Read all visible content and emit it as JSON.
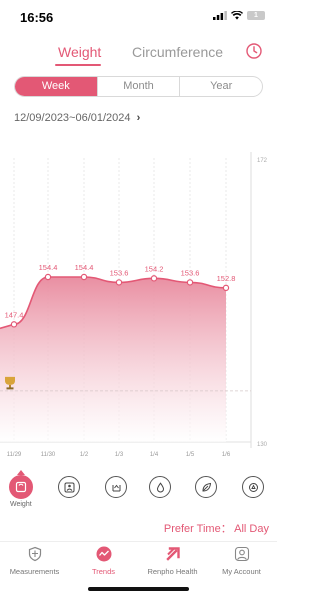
{
  "status": {
    "time": "16:56",
    "battery": "1"
  },
  "tabs": [
    {
      "label": "Weight",
      "active": true
    },
    {
      "label": "Circumference",
      "active": false
    }
  ],
  "period": {
    "options": [
      "Week",
      "Month",
      "Year"
    ],
    "selected": "Week"
  },
  "date_range": "12/09/2023~06/01/2024",
  "date_range_arrow": "›",
  "chart_data": {
    "type": "area",
    "x": [
      "11/29",
      "11/30",
      "1/2",
      "1/3",
      "1/4",
      "1/5",
      "1/6"
    ],
    "values": [
      147.4,
      154.4,
      154.4,
      153.6,
      154.2,
      153.6,
      152.8
    ],
    "value_labels": [
      "147.4",
      "154.4",
      "154.4",
      "153.6",
      "154.2",
      "153.6",
      "152.8"
    ],
    "y_axis_labels": [
      "172",
      "130"
    ],
    "ylim": [
      130,
      172
    ],
    "goal_marker": "trophy-icon",
    "grid": true,
    "colors": {
      "line": "#e35875",
      "fill_top": "#e8899d",
      "fill_bottom": "#ffffff"
    }
  },
  "metrics": [
    {
      "icon": "scale-icon",
      "label": "Weight",
      "active": true
    },
    {
      "icon": "body-fat-icon",
      "label": "",
      "active": false
    },
    {
      "icon": "muscle-icon",
      "label": "",
      "active": false
    },
    {
      "icon": "water-drop-icon",
      "label": "",
      "active": false
    },
    {
      "icon": "leaf-icon",
      "label": "",
      "active": false
    },
    {
      "icon": "bmr-icon",
      "label": "",
      "active": false
    }
  ],
  "prefer_time": "Prefer Time： All Day",
  "nav": [
    {
      "label": "Measurements",
      "icon": "shield-icon",
      "active": false
    },
    {
      "label": "Trends",
      "icon": "trends-icon",
      "active": true
    },
    {
      "label": "Renpho Health",
      "icon": "renpho-logo-icon",
      "active": false
    },
    {
      "label": "My Account",
      "icon": "account-icon",
      "active": false
    }
  ],
  "accent_color": "#e35875"
}
